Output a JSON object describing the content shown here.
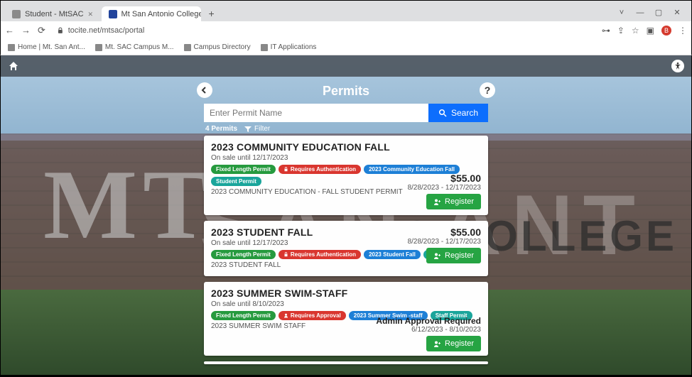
{
  "browser": {
    "tabs": [
      {
        "title": "Student - MtSAC"
      },
      {
        "title": "Mt San Antonio College Citizen I"
      }
    ],
    "url": "tocite.net/mtsac/portal",
    "bookmarks": [
      "Home | Mt. San Ant...",
      "Mt. SAC Campus M...",
      "Campus Directory",
      "IT Applications"
    ],
    "profile_initial": "B"
  },
  "page": {
    "title": "Permits",
    "search_placeholder": "Enter Permit Name",
    "search_button": "Search",
    "count_label": "4 Permits",
    "filter_label": "Filter",
    "bg_left": "MT.",
    "bg_mid": "SAN ANT",
    "bg_right": "NIO COLLEGE"
  },
  "tags": {
    "fixed": "Fixed Length Permit",
    "auth": "Requires Authentication",
    "approval": "Requires Approval",
    "student": "Student Permit",
    "staff": "Staff Permit"
  },
  "register_label": "Register",
  "cards": [
    {
      "title": "2023 COMMUNITY EDUCATION FALL",
      "sale": "On sale until 12/17/2023",
      "desc": "2023 COMMUNITY EDUCATION - FALL STUDENT PERMIT",
      "cat_tag": "2023 Community Education Fall",
      "price": "$55.00",
      "dates": "8/28/2023 - 12/17/2023"
    },
    {
      "title": "2023 STUDENT FALL",
      "sale": "On sale until 12/17/2023",
      "desc": "2023 STUDENT FALL",
      "cat_tag": "2023 Student Fall",
      "price": "$55.00",
      "dates": "8/28/2023 - 12/17/2023"
    },
    {
      "title": "2023 SUMMER SWIM-STAFF",
      "sale": "On sale until 8/10/2023",
      "desc": "2023 SUMMER SWIM STAFF",
      "cat_tag": "2023 Summer Swim -staff",
      "approval": "Admin Approval Required",
      "dates": "6/12/2023 - 8/10/2023"
    }
  ]
}
